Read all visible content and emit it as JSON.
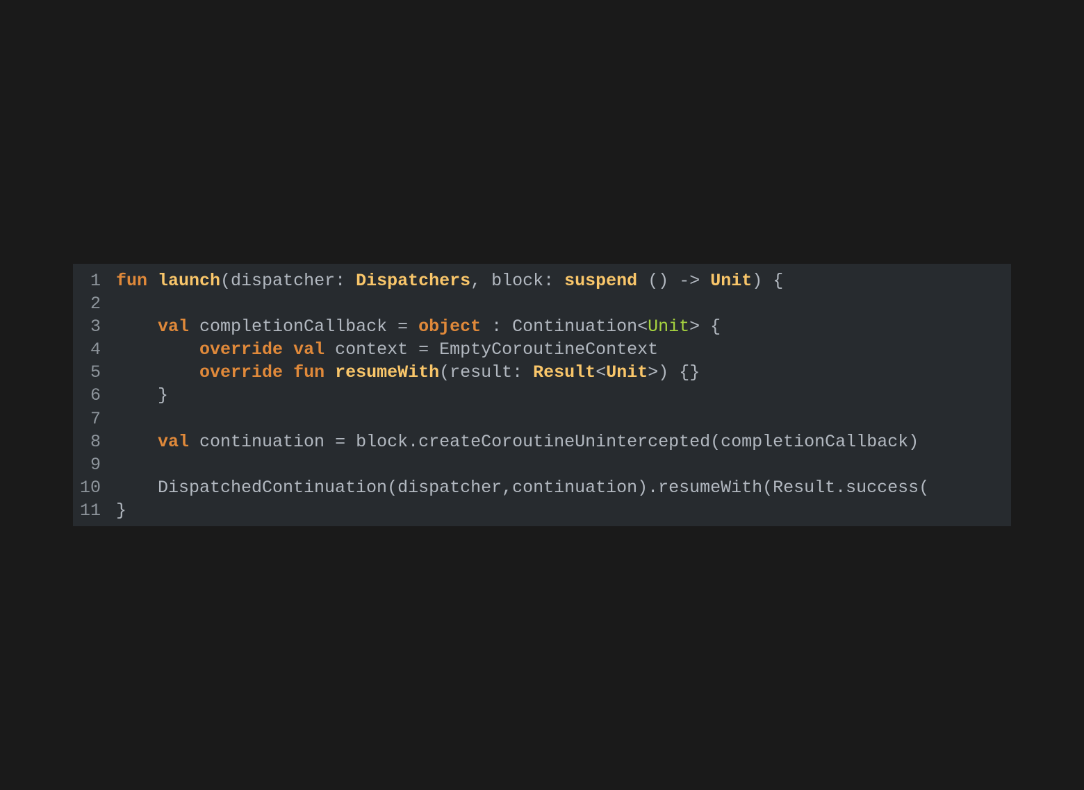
{
  "editor": {
    "language": "kotlin",
    "colors": {
      "page_background": "#1a1a1a",
      "editor_background": "#272b2f",
      "line_number": "#8e959c",
      "keyword": "#e0893a",
      "function_and_type": "#f9c66a",
      "generic_type_arg": "#a6d33f",
      "plain_text": "#b2b8c0"
    },
    "lines": [
      {
        "number": "1",
        "tokens": [
          {
            "text": "fun",
            "kind": "kw"
          },
          {
            "text": " ",
            "kind": "plain"
          },
          {
            "text": "launch",
            "kind": "fn"
          },
          {
            "text": "(dispatcher: ",
            "kind": "plain"
          },
          {
            "text": "Dispatchers",
            "kind": "type"
          },
          {
            "text": ", block: ",
            "kind": "plain"
          },
          {
            "text": "suspend",
            "kind": "type"
          },
          {
            "text": " () -> ",
            "kind": "plain"
          },
          {
            "text": "Unit",
            "kind": "type"
          },
          {
            "text": ") {",
            "kind": "plain"
          }
        ]
      },
      {
        "number": "2",
        "tokens": []
      },
      {
        "number": "3",
        "tokens": [
          {
            "text": "    ",
            "kind": "plain"
          },
          {
            "text": "val",
            "kind": "kw"
          },
          {
            "text": " completionCallback = ",
            "kind": "plain"
          },
          {
            "text": "object",
            "kind": "kw"
          },
          {
            "text": " : Continuation<",
            "kind": "plain"
          },
          {
            "text": "Unit",
            "kind": "green"
          },
          {
            "text": "> {",
            "kind": "plain"
          }
        ]
      },
      {
        "number": "4",
        "tokens": [
          {
            "text": "        ",
            "kind": "plain"
          },
          {
            "text": "override",
            "kind": "kw"
          },
          {
            "text": " ",
            "kind": "plain"
          },
          {
            "text": "val",
            "kind": "kw"
          },
          {
            "text": " context = EmptyCoroutineContext",
            "kind": "plain"
          }
        ]
      },
      {
        "number": "5",
        "tokens": [
          {
            "text": "        ",
            "kind": "plain"
          },
          {
            "text": "override",
            "kind": "kw"
          },
          {
            "text": " ",
            "kind": "plain"
          },
          {
            "text": "fun",
            "kind": "kw"
          },
          {
            "text": " ",
            "kind": "plain"
          },
          {
            "text": "resumeWith",
            "kind": "fn"
          },
          {
            "text": "(result: ",
            "kind": "plain"
          },
          {
            "text": "Result",
            "kind": "type"
          },
          {
            "text": "<",
            "kind": "plain"
          },
          {
            "text": "Unit",
            "kind": "type"
          },
          {
            "text": ">) {}",
            "kind": "plain"
          }
        ]
      },
      {
        "number": "6",
        "tokens": [
          {
            "text": "    }",
            "kind": "plain"
          }
        ]
      },
      {
        "number": "7",
        "tokens": []
      },
      {
        "number": "8",
        "tokens": [
          {
            "text": "    ",
            "kind": "plain"
          },
          {
            "text": "val",
            "kind": "kw"
          },
          {
            "text": " continuation = block.createCoroutineUnintercepted(completionCallback)",
            "kind": "plain"
          }
        ]
      },
      {
        "number": "9",
        "tokens": []
      },
      {
        "number": "10",
        "tokens": [
          {
            "text": "    DispatchedContinuation(dispatcher,continuation).resumeWith(Result.success(",
            "kind": "plain"
          }
        ]
      },
      {
        "number": "11",
        "tokens": [
          {
            "text": "}",
            "kind": "plain"
          }
        ]
      }
    ]
  }
}
